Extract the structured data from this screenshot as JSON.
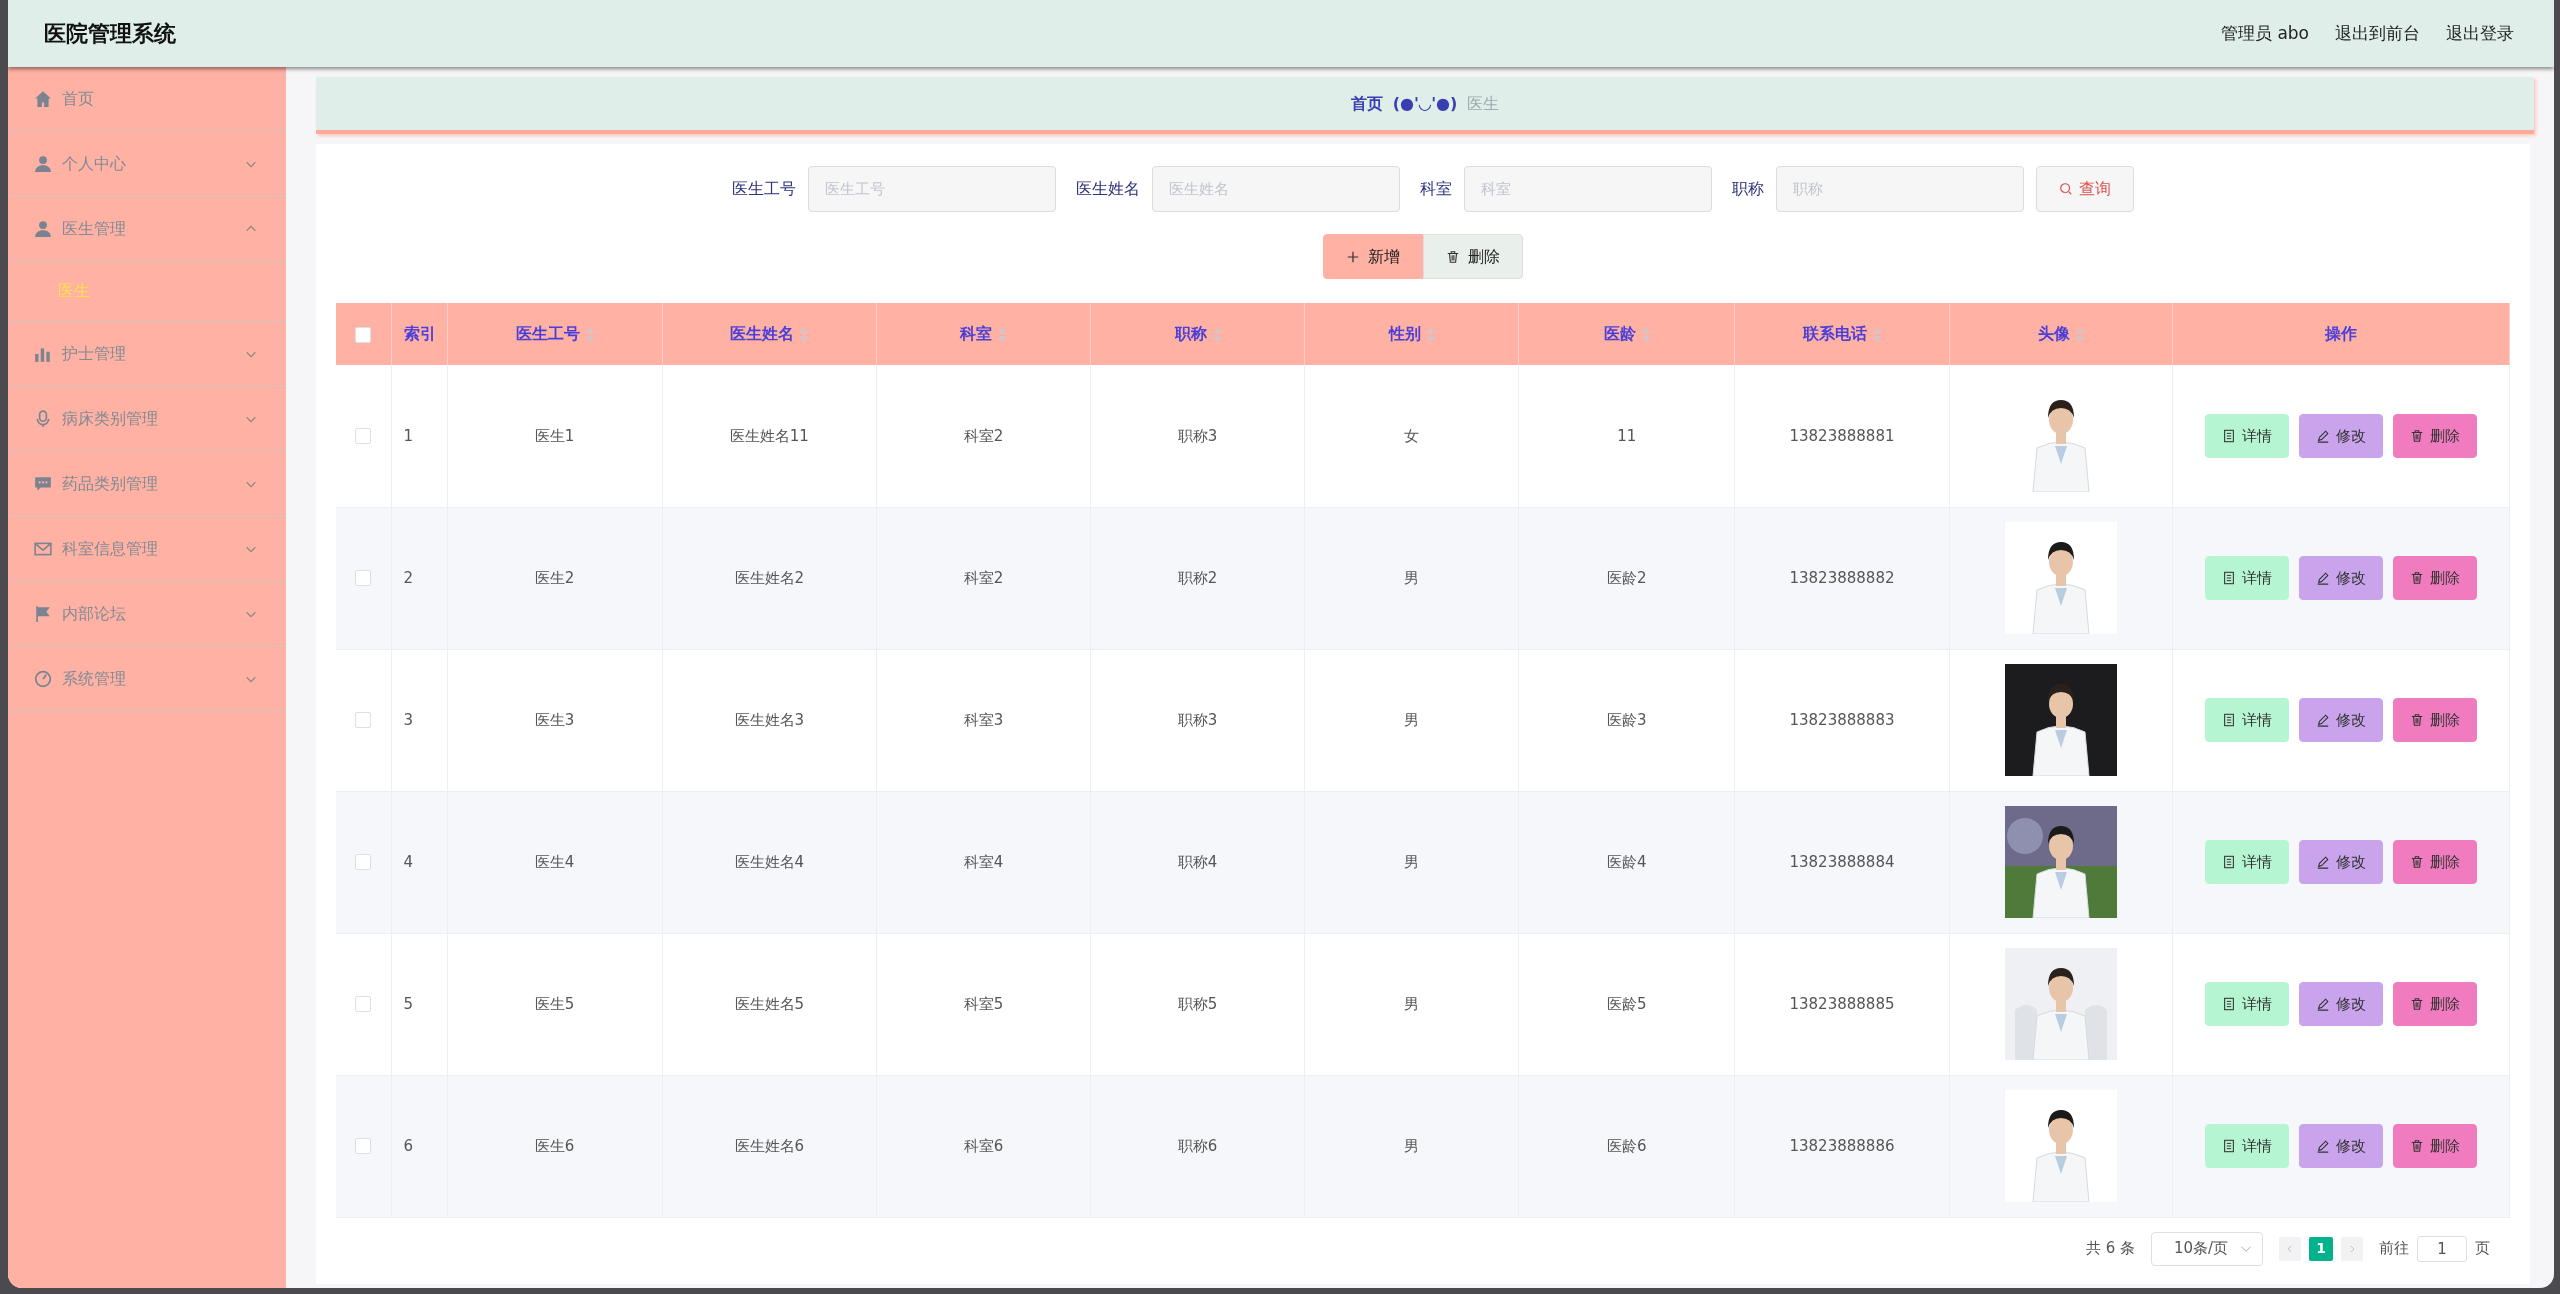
{
  "header": {
    "title": "医院管理系统",
    "user": "管理员 abo",
    "links": [
      "退出到前台",
      "退出登录"
    ]
  },
  "sidebar": {
    "items": [
      {
        "label": "首页"
      },
      {
        "label": "个人中心",
        "expanded": false
      },
      {
        "label": "医生管理",
        "expanded": true,
        "children": [
          {
            "label": "医生",
            "selected": true
          }
        ]
      },
      {
        "label": "护士管理",
        "expanded": false
      },
      {
        "label": "病床类别管理",
        "expanded": false
      },
      {
        "label": "药品类别管理",
        "expanded": false
      },
      {
        "label": "科室信息管理",
        "expanded": false
      },
      {
        "label": "内部论坛",
        "expanded": false
      },
      {
        "label": "系统管理",
        "expanded": false
      }
    ]
  },
  "breadcrumb": {
    "home": "首页",
    "emoticon": "(●'◡'●)",
    "current": "医生"
  },
  "search": {
    "fields": [
      {
        "label": "医生工号",
        "placeholder": "医生工号"
      },
      {
        "label": "医生姓名",
        "placeholder": "医生姓名"
      },
      {
        "label": "科室",
        "placeholder": "科室"
      },
      {
        "label": "职称",
        "placeholder": "职称"
      }
    ],
    "button": "查询"
  },
  "toolbar": [
    {
      "label": "新增",
      "kind": "add"
    },
    {
      "label": "删除",
      "kind": "delete"
    }
  ],
  "table": {
    "select_all": false,
    "columns": [
      {
        "label": "索引",
        "sortable": false
      },
      {
        "label": "医生工号",
        "sortable": true
      },
      {
        "label": "医生姓名",
        "sortable": true
      },
      {
        "label": "科室",
        "sortable": true
      },
      {
        "label": "职称",
        "sortable": true
      },
      {
        "label": "性别",
        "sortable": true
      },
      {
        "label": "医龄",
        "sortable": true
      },
      {
        "label": "联系电话",
        "sortable": true
      },
      {
        "label": "头像",
        "sortable": true
      },
      {
        "label": "操作",
        "sortable": false
      }
    ],
    "rows": [
      {
        "checked": false,
        "cells": [
          "1",
          "医生1",
          "医生姓名11",
          "科室2",
          "职称3",
          "女",
          "11",
          "13823888881"
        ],
        "avatar": {
          "kind": "picture"
        },
        "actions": [
          {
            "label": "详情",
            "kind": "detail"
          },
          {
            "label": "修改",
            "kind": "edit"
          },
          {
            "label": "删除",
            "kind": "delete"
          }
        ]
      },
      {
        "checked": false,
        "cells": [
          "2",
          "医生2",
          "医生姓名2",
          "科室2",
          "职称2",
          "男",
          "医龄2",
          "13823888882"
        ],
        "avatar": {
          "kind": "picture"
        },
        "actions": [
          {
            "label": "详情",
            "kind": "detail"
          },
          {
            "label": "修改",
            "kind": "edit"
          },
          {
            "label": "删除",
            "kind": "delete"
          }
        ]
      },
      {
        "checked": false,
        "cells": [
          "3",
          "医生3",
          "医生姓名3",
          "科室3",
          "职称3",
          "男",
          "医龄3",
          "13823888883"
        ],
        "avatar": {
          "kind": "picture"
        },
        "actions": [
          {
            "label": "详情",
            "kind": "detail"
          },
          {
            "label": "修改",
            "kind": "edit"
          },
          {
            "label": "删除",
            "kind": "delete"
          }
        ]
      },
      {
        "checked": false,
        "cells": [
          "4",
          "医生4",
          "医生姓名4",
          "科室4",
          "职称4",
          "男",
          "医龄4",
          "13823888884"
        ],
        "avatar": {
          "kind": "picture"
        },
        "actions": [
          {
            "label": "详情",
            "kind": "detail"
          },
          {
            "label": "修改",
            "kind": "edit"
          },
          {
            "label": "删除",
            "kind": "delete"
          }
        ]
      },
      {
        "checked": false,
        "cells": [
          "5",
          "医生5",
          "医生姓名5",
          "科室5",
          "职称5",
          "男",
          "医龄5",
          "13823888885"
        ],
        "avatar": {
          "kind": "picture"
        },
        "actions": [
          {
            "label": "详情",
            "kind": "detail"
          },
          {
            "label": "修改",
            "kind": "edit"
          },
          {
            "label": "删除",
            "kind": "delete"
          }
        ]
      },
      {
        "checked": false,
        "cells": [
          "6",
          "医生6",
          "医生姓名6",
          "科室6",
          "职称6",
          "男",
          "医龄6",
          "13823888886"
        ],
        "avatar": {
          "kind": "picture"
        },
        "actions": [
          {
            "label": "详情",
            "kind": "detail"
          },
          {
            "label": "修改",
            "kind": "edit"
          },
          {
            "label": "删除",
            "kind": "delete"
          }
        ]
      }
    ]
  },
  "pagination": {
    "total": "共 6 条",
    "page_size": "10条/页",
    "pages": [
      {
        "label": "1",
        "selected": true
      }
    ],
    "goto_label": "前往",
    "goto_value": "1",
    "goto_unit": "页"
  }
}
